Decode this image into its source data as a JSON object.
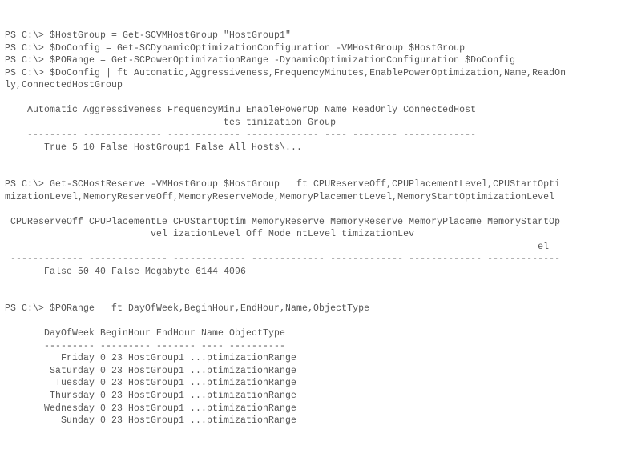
{
  "block1_cmds": [
    "PS C:\\> $HostGroup = Get-SCVMHostGroup \"HostGroup1\"",
    "PS C:\\> $DoConfig = Get-SCDynamicOptimizationConfiguration -VMHostGroup $HostGroup",
    "PS C:\\> $PORange = Get-SCPowerOptimizationRange -DynamicOptimizationConfiguration $DoConfig",
    "PS C:\\> $DoConfig | ft Automatic,Aggressiveness,FrequencyMinutes,EnablePowerOptimization,Name,ReadOn",
    "ly,ConnectedHostGroup"
  ],
  "block1_head1": "    Automatic Aggressiveness FrequencyMinu EnablePowerOp Name ReadOnly ConnectedHost",
  "block1_head2": "                                       tes timization Group",
  "block1_sep": "    --------- -------------- ------------- ------------- ---- -------- -------------",
  "block1_row": "       True 5 10 False HostGroup1 False All Hosts\\...",
  "block2_cmds": [
    "PS C:\\> Get-SCHostReserve -VMHostGroup $HostGroup | ft CPUReserveOff,CPUPlacementLevel,CPUStartOpti",
    "mizationLevel,MemoryReserveOff,MemoryReserveMode,MemoryPlacementLevel,MemoryStartOptimizationLevel"
  ],
  "block2_head1": " CPUReserveOff CPUPlacementLe CPUStartOptim MemoryReserve MemoryReserve MemoryPlaceme MemoryStartOp",
  "block2_head2": "                          vel izationLevel Off Mode ntLevel timizationLev",
  "block2_head3": "                                                                                               el",
  "block2_sep": " ------------- -------------- ------------- ------------- ------------- ------------- -------------",
  "block2_row": "       False 50 40 False Megabyte 6144 4096",
  "block3_cmd": "PS C:\\> $PORange | ft DayOfWeek,BeginHour,EndHour,Name,ObjectType",
  "block3_head": "       DayOfWeek BeginHour EndHour Name ObjectType",
  "block3_sep": "       --------- --------- ------- ---- ----------",
  "block3_rows": [
    "          Friday 0 23 HostGroup1 ...ptimizationRange",
    "        Saturday 0 23 HostGroup1 ...ptimizationRange",
    "         Tuesday 0 23 HostGroup1 ...ptimizationRange",
    "        Thursday 0 23 HostGroup1 ...ptimizationRange",
    "       Wednesday 0 23 HostGroup1 ...ptimizationRange",
    "          Sunday 0 23 HostGroup1 ...ptimizationRange"
  ]
}
